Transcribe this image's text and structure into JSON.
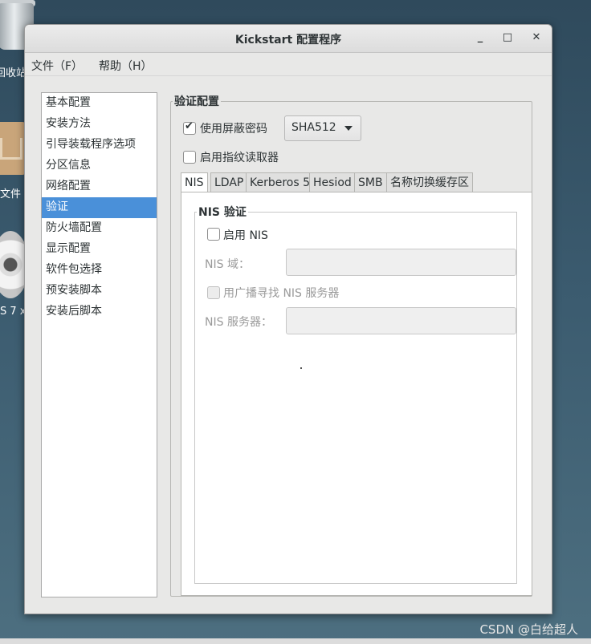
{
  "desktop": {
    "trash_label": "回收站",
    "home_label": "文件",
    "disc_label": "S 7 x"
  },
  "window": {
    "title": "Kickstart 配置程序",
    "minimize": "_",
    "maximize": "□",
    "close": "✕"
  },
  "menu": {
    "file": "文件（F）",
    "help": "帮助（H）"
  },
  "nav": {
    "items": [
      {
        "label": "基本配置"
      },
      {
        "label": "安装方法"
      },
      {
        "label": "引导装载程序选项"
      },
      {
        "label": "分区信息"
      },
      {
        "label": "网络配置"
      },
      {
        "label": "验证"
      },
      {
        "label": "防火墙配置"
      },
      {
        "label": "显示配置"
      },
      {
        "label": "软件包选择"
      },
      {
        "label": "预安装脚本"
      },
      {
        "label": "安装后脚本"
      }
    ],
    "selected": "验证"
  },
  "auth": {
    "section_title": "验证配置",
    "shadow_password_label": "使用屏蔽密码",
    "shadow_password_checked": true,
    "hash_algorithm": "SHA512",
    "fingerprint_label": "启用指纹读取器",
    "fingerprint_checked": false,
    "tabs": [
      {
        "label": "NIS"
      },
      {
        "label": "LDAP"
      },
      {
        "label": "Kerberos 5"
      },
      {
        "label": "Hesiod"
      },
      {
        "label": "SMB"
      },
      {
        "label": "名称切换缓存区"
      }
    ],
    "active_tab": "NIS",
    "nis": {
      "frame_title": "NIS 验证",
      "enable_label": "启用  NIS",
      "enable_checked": false,
      "domain_label": "NIS 域：",
      "domain_value": "",
      "broadcast_label": "用广播寻找  NIS 服务器",
      "broadcast_checked": false,
      "server_label": "NIS 服务器：",
      "server_value": ""
    }
  },
  "watermark": "CSDN @白给超人"
}
